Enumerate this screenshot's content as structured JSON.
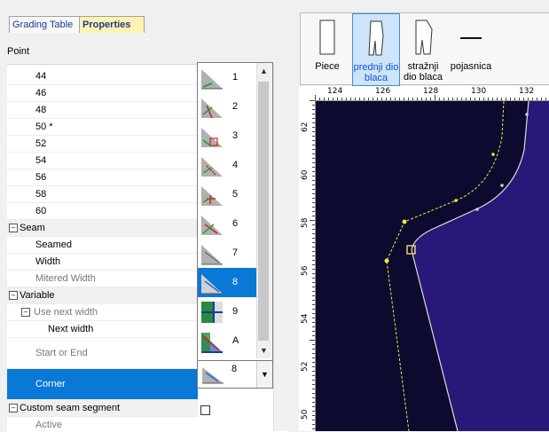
{
  "tabs": [
    "Grading Table",
    "Properties"
  ],
  "active_tab": "Properties",
  "section_label": "Point",
  "grid_rows": [
    {
      "text": "44",
      "kind": "value"
    },
    {
      "text": "46",
      "kind": "value"
    },
    {
      "text": "48",
      "kind": "value"
    },
    {
      "text": "50 *",
      "kind": "value"
    },
    {
      "text": "52",
      "kind": "value"
    },
    {
      "text": "54",
      "kind": "value"
    },
    {
      "text": "56",
      "kind": "value"
    },
    {
      "text": "58",
      "kind": "value"
    },
    {
      "text": "60",
      "kind": "value"
    },
    {
      "text": "Seam",
      "kind": "category"
    },
    {
      "text": "Seamed",
      "kind": "prop"
    },
    {
      "text": "Width",
      "kind": "prop"
    },
    {
      "text": "Mitered Width",
      "kind": "prop-gray"
    },
    {
      "text": "Variable",
      "kind": "category"
    },
    {
      "text": "Use next width",
      "kind": "sub-gray"
    },
    {
      "text": "Next width",
      "kind": "subsub"
    },
    {
      "text": "Start or End",
      "kind": "prop-gray-tall"
    },
    {
      "text": "Corner",
      "kind": "selected-tall"
    },
    {
      "text": "Custom seam segment",
      "kind": "category"
    },
    {
      "text": "Active",
      "kind": "sub-gray"
    }
  ],
  "corner_dropdown": {
    "items": [
      "1",
      "2",
      "3",
      "4",
      "5",
      "6",
      "7",
      "8",
      "9",
      "A"
    ],
    "selected": "8",
    "current_value": "8"
  },
  "pieces": [
    {
      "label": "Piece",
      "selected": false
    },
    {
      "label": "prednji dio blaca",
      "selected": true
    },
    {
      "label": "stražnji dio blaca",
      "selected": false
    },
    {
      "label": "pojasnica",
      "selected": false
    }
  ],
  "ruler_top": [
    "124",
    "126",
    "128",
    "130",
    "132"
  ],
  "ruler_left": [
    "62",
    "60",
    "58",
    "56",
    "54",
    "52",
    "50"
  ],
  "colors": {
    "selection": "#0a78d7",
    "canvas_bg": "#0c0a2e",
    "piece_fill": "#2a1878",
    "active_tab_bg": "#fff3b0"
  }
}
